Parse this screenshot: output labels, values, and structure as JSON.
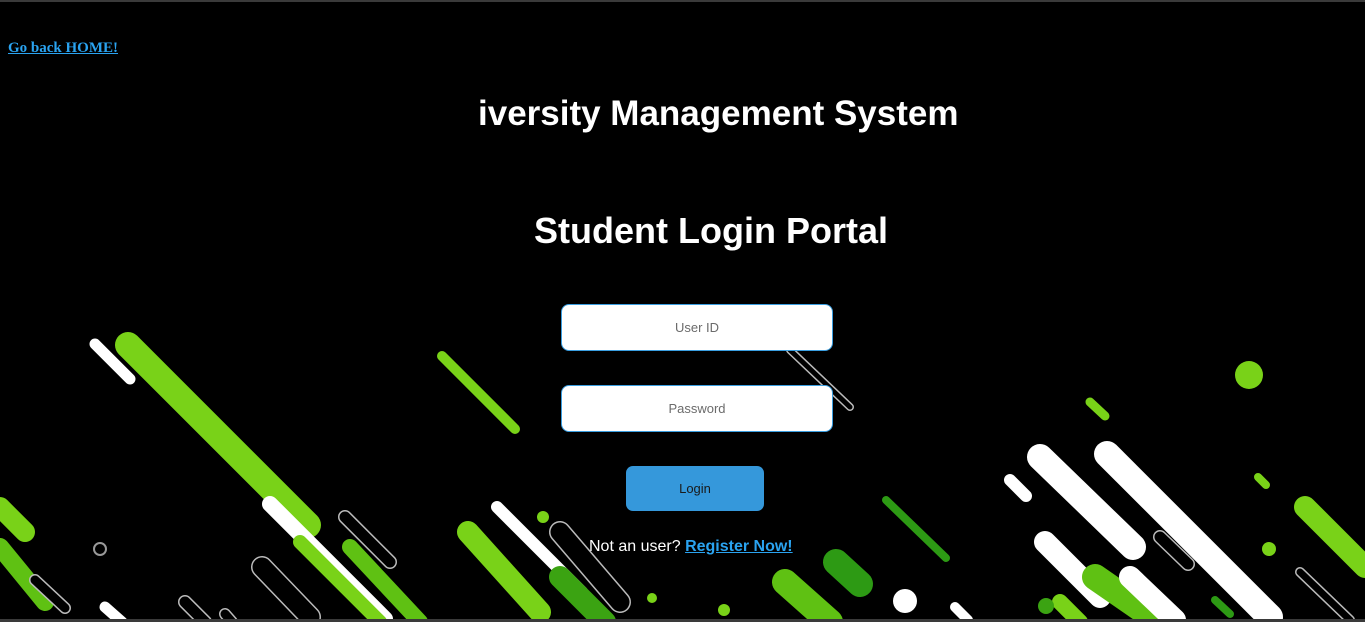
{
  "nav": {
    "home_link": "Go back HOME!"
  },
  "header": {
    "app_title": "iversity Management System",
    "portal_title": "Student Login Portal"
  },
  "form": {
    "userid_placeholder": "User ID",
    "password_placeholder": "Password",
    "login_label": "Login",
    "register_prompt": "Not an user?",
    "register_link": "Register Now!"
  },
  "colors": {
    "background": "#000000",
    "link": "#2aa3f0",
    "button": "#3598db",
    "field_border": "#3a9ee0",
    "accent_green": "#7ed321"
  }
}
